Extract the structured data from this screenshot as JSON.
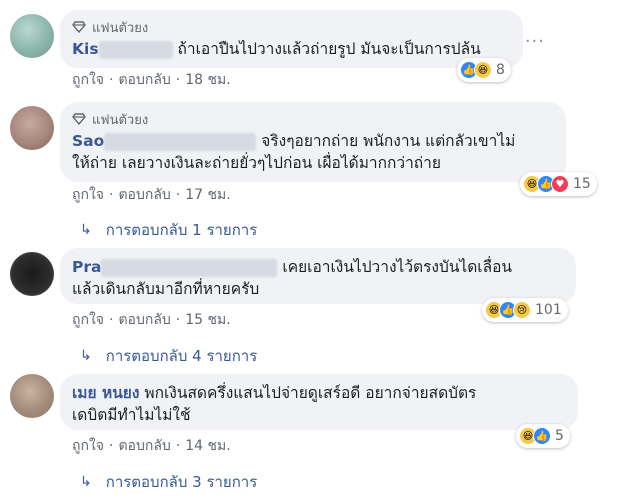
{
  "comments": [
    {
      "fan_label": "แฟนตัวยง",
      "author_visible": "Kis",
      "text": "ถ้าเอาปืนไปวางแล้วถ่ายรูป มันจะเป็นการปล้น",
      "text_line2": "",
      "reaction_count": "8",
      "like_label": "ถูกใจ",
      "reply_label": "ตอบกลับ",
      "time": "18 ชม.",
      "replies_label": ""
    },
    {
      "fan_label": "แฟนตัวยง",
      "author_visible": "Sao",
      "text": "จริงๆอยากถ่าย    พนักงาน แต่กลัวเขาไม่",
      "text_line2": "ให้ถ่าย เลยวางเงินละถ่ายยั่วๆไปก่อน เผื่อได้มากกว่าถ่าย",
      "reaction_count": "15",
      "like_label": "ถูกใจ",
      "reply_label": "ตอบกลับ",
      "time": "17 ชม.",
      "replies_label": "การตอบกลับ 1 รายการ"
    },
    {
      "fan_label": "",
      "author_visible": "Pra",
      "text": "เคยเอาเงินไปวางไว้ตรงบันไดเลื่อน",
      "text_line2": "แล้วเดินกลับมาอีกที่หายครับ",
      "reaction_count": "101",
      "like_label": "ถูกใจ",
      "reply_label": "ตอบกลับ",
      "time": "15 ชม.",
      "replies_label": "การตอบกลับ 4 รายการ"
    },
    {
      "fan_label": "",
      "author_visible": "เมย หนยง",
      "text": "พกเงินสดครึ่งแสนไปจ่ายดูเสร์อดี อยากจ่ายสดบัตร",
      "text_line2": "เดบิตมีทำไมไม่ใช้",
      "reaction_count": "5",
      "like_label": "ถูกใจ",
      "reply_label": "ตอบกลับ",
      "time": "14 ชม.",
      "replies_label": "การตอบกลับ 3 รายการ"
    }
  ],
  "more_icon": "more-options-icon",
  "colors": {
    "link": "#385898",
    "bubble": "#f0f2f5",
    "meta": "#606770"
  }
}
